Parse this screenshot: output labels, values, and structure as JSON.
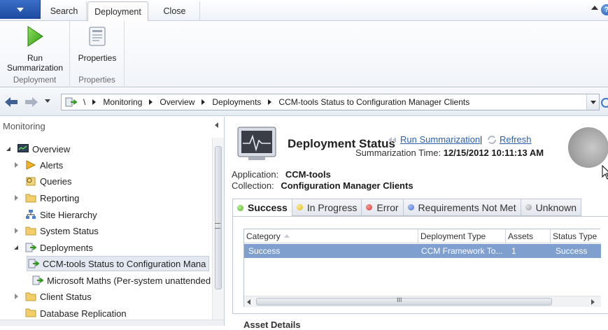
{
  "ribbon_tabs": {
    "search": "Search",
    "deployment": "Deployment",
    "close": "Close"
  },
  "ribbon": {
    "run_label_1": "Run",
    "run_label_2": "Summarization",
    "properties_label": "Properties",
    "group_deployment": "Deployment",
    "group_properties": "Properties"
  },
  "breadcrumb": {
    "root": "\\",
    "items": [
      "Monitoring",
      "Overview",
      "Deployments",
      "CCM-tools Status to Configuration Manager Clients"
    ]
  },
  "nav": {
    "header": "Monitoring",
    "items": [
      {
        "label": "Overview"
      },
      {
        "label": "Alerts"
      },
      {
        "label": "Queries"
      },
      {
        "label": "Reporting"
      },
      {
        "label": "Site Hierarchy"
      },
      {
        "label": "System Status"
      },
      {
        "label": "Deployments"
      },
      {
        "label": "CCM-tools Status to Configuration Mana"
      },
      {
        "label": "Microsoft Maths (Per-system unattended"
      },
      {
        "label": "Client Status"
      },
      {
        "label": "Database Replication"
      }
    ]
  },
  "detail": {
    "title": "Deployment Status",
    "run_link": "Run Summarization",
    "separator": "|",
    "refresh_link": "Refresh",
    "summary_time_label": "Summarization Time:",
    "summary_time_value": "12/15/2012 10:11:13 AM",
    "application_label": "Application:",
    "application_value": "CCM-tools",
    "collection_label": "Collection:",
    "collection_value": "Configuration Manager Clients",
    "status_tabs": [
      {
        "label": "Success",
        "color": "#53b52a"
      },
      {
        "label": "In Progress",
        "color": "#e3b81a"
      },
      {
        "label": "Error",
        "color": "#d63a32"
      },
      {
        "label": "Requirements Not Met",
        "color": "#4a6fd0"
      },
      {
        "label": "Unknown",
        "color": "#9a9a9a"
      }
    ],
    "grid": {
      "columns": [
        "Category",
        "Deployment Type",
        "Assets",
        "Status Type"
      ],
      "rows": [
        {
          "category": "Success",
          "deployment_type": "CCM Framework To...",
          "assets": "1",
          "status_type": "Success"
        }
      ]
    },
    "hscroll_grip": "III",
    "asset_details": "Asset Details"
  },
  "colors": {
    "accent": "#1d4aa0",
    "selection": "#7f9fcf",
    "link": "#2a5fb0"
  }
}
